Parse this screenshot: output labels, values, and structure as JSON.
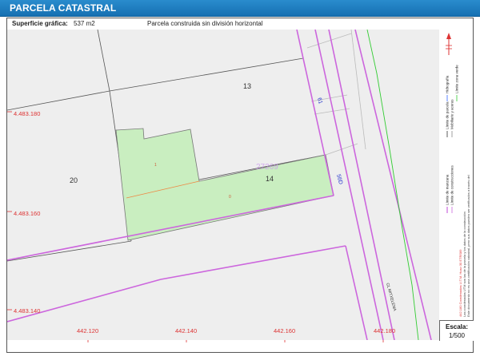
{
  "header": {
    "title": "PARCELA CATASTRAL"
  },
  "info": {
    "surface_label": "Superficie gráfica:",
    "surface_value": "537 m2",
    "description": "Parcela construida sin división horizontal"
  },
  "map": {
    "parcel_numbers": [
      "13",
      "20",
      "14"
    ],
    "selected_block": "27269",
    "unit_labels": [
      "1",
      "0"
    ],
    "block_labels": [
      "61",
      "56D"
    ],
    "street_name": "CL MITXELENA",
    "y_coords": [
      "4.483.180",
      "4.483.160",
      "4.483.140"
    ],
    "x_coords": [
      "442.120",
      "442.140",
      "442.160",
      "442.180"
    ],
    "colors": {
      "parcel_fill": "#c9eec0",
      "parcel_stroke": "#777777",
      "street_line": "#cc66dd",
      "green_line": "#33cc33",
      "coord_text": "#dd3333",
      "block_text": "#2233cc",
      "map_bg": "#eeeeee"
    }
  },
  "legend": {
    "items": [
      {
        "label": "Límite de manzana",
        "color": "#cc66dd"
      },
      {
        "label": "Límite de parcela",
        "color": "#333333"
      },
      {
        "label": "Límite de construcciones",
        "color": "#cc66dd"
      },
      {
        "label": "Mobiliario y aceras",
        "color": "#888888"
      },
      {
        "label": "Límite zona verde",
        "color": "#33cc33"
      },
      {
        "label": "Hidrografía",
        "color": "#3366ff"
      }
    ],
    "note": "Este documento no es una certificación catastral, pero sus datos pueden ser verificados a través del",
    "note2": "Las coordenadas UTM son las de la parcela y los datos de la construcción",
    "projection": "442.180 Coordenadas U.T.M. Huso 30 ETRS89"
  },
  "scale": {
    "label": "Escala:",
    "value": "1/500"
  }
}
